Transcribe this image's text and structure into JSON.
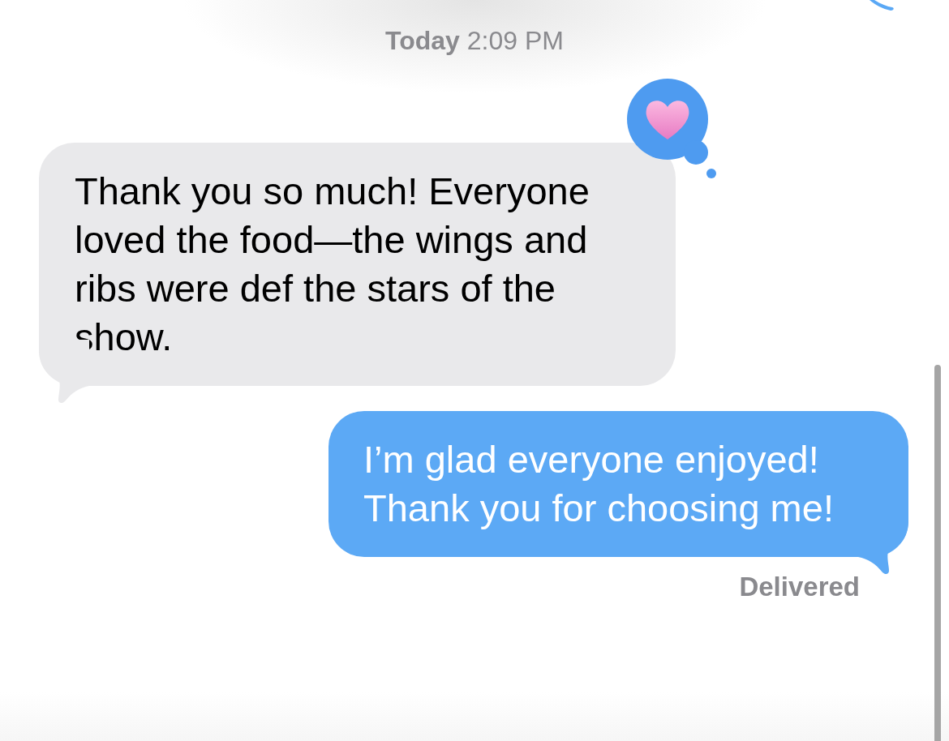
{
  "timestamp": "**Today** 2:09 PM",
  "messages": [
    {
      "kind": "received",
      "text": "Thank you so much! Everyone loved the food—the wings and ribs were def the stars of the show.",
      "reaction": {
        "kind": "heart"
      }
    },
    {
      "kind": "sent",
      "text": "I’m glad everyone enjoyed! Thank you for choosing me!",
      "status": "Delivered"
    }
  ]
}
